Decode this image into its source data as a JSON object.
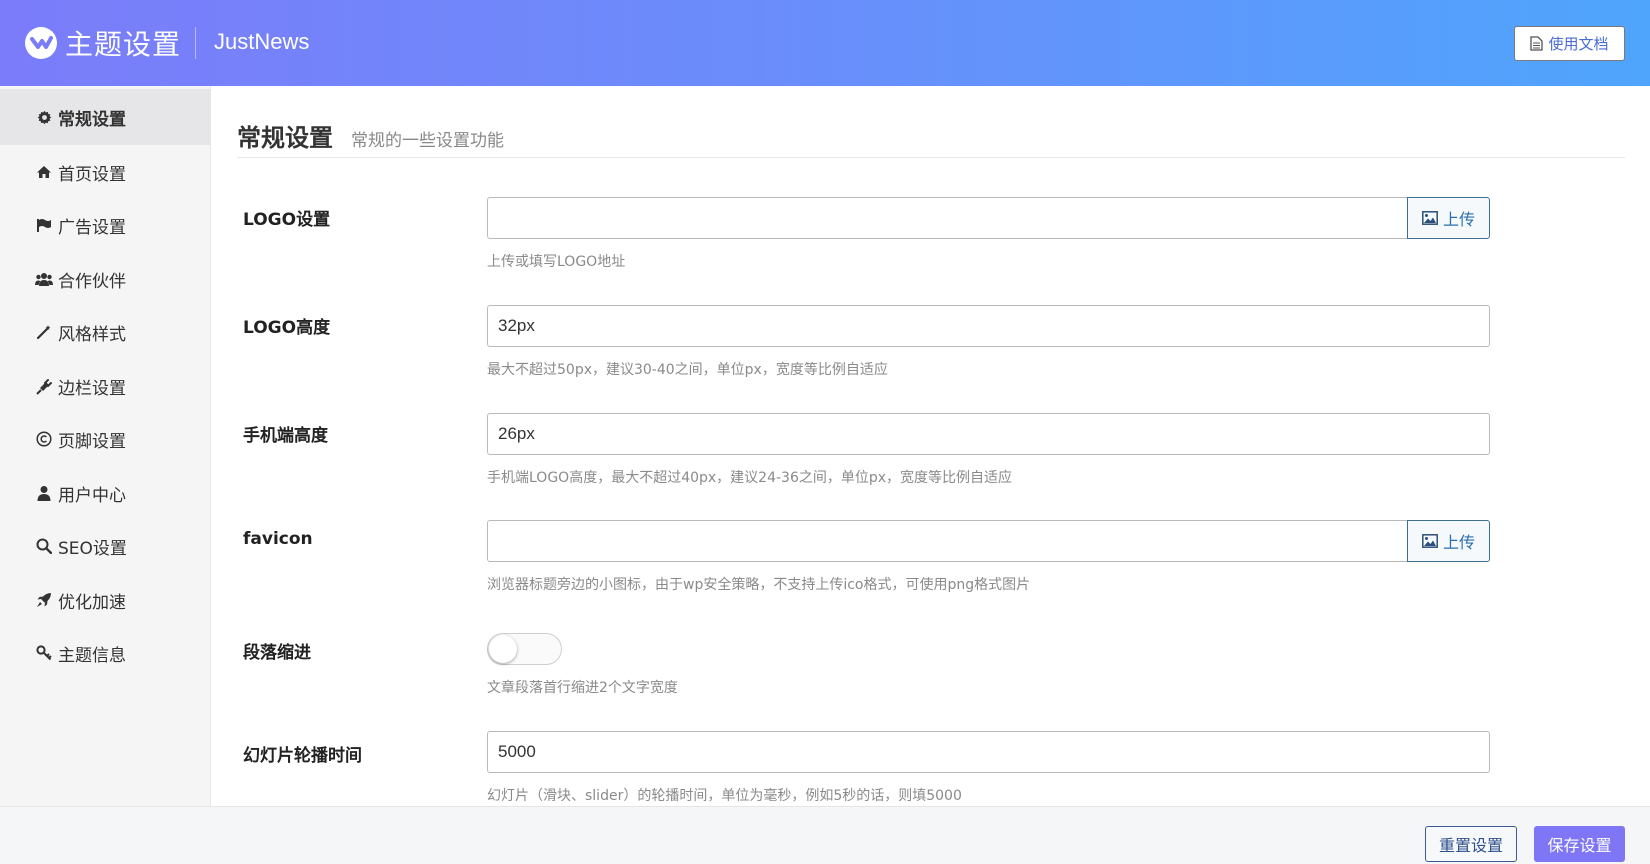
{
  "header": {
    "title": "主题设置",
    "subtitle": "JustNews",
    "docs_button": "使用文档"
  },
  "sidebar": {
    "items": [
      {
        "label": "常规设置",
        "icon": "gear-icon",
        "active": true
      },
      {
        "label": "首页设置",
        "icon": "home-icon",
        "active": false
      },
      {
        "label": "广告设置",
        "icon": "flag-icon",
        "active": false
      },
      {
        "label": "合作伙伴",
        "icon": "users-icon",
        "active": false
      },
      {
        "label": "风格样式",
        "icon": "magic-wand-icon",
        "active": false
      },
      {
        "label": "边栏设置",
        "icon": "plug-icon",
        "active": false
      },
      {
        "label": "页脚设置",
        "icon": "copyright-icon",
        "active": false
      },
      {
        "label": "用户中心",
        "icon": "user-icon",
        "active": false
      },
      {
        "label": "SEO设置",
        "icon": "search-icon",
        "active": false
      },
      {
        "label": "优化加速",
        "icon": "rocket-icon",
        "active": false
      },
      {
        "label": "主题信息",
        "icon": "key-icon",
        "active": false
      }
    ]
  },
  "main": {
    "title": "常规设置",
    "subtitle": "常规的一些设置功能",
    "fields": {
      "logo": {
        "label": "LOGO设置",
        "value": "",
        "button": "上传",
        "help": "上传或填写LOGO地址"
      },
      "logo_height": {
        "label": "LOGO高度",
        "value": "32px",
        "help": "最大不超过50px，建议30-40之间，单位px，宽度等比例自适应"
      },
      "mobile_height": {
        "label": "手机端高度",
        "value": "26px",
        "help": "手机端LOGO高度，最大不超过40px，建议24-36之间，单位px，宽度等比例自适应"
      },
      "favicon": {
        "label": "favicon",
        "value": "",
        "button": "上传",
        "help": "浏览器标题旁边的小图标，由于wp安全策略，不支持上传ico格式，可使用png格式图片"
      },
      "indent": {
        "label": "段落缩进",
        "enabled": false,
        "help": "文章段落首行缩进2个文字宽度"
      },
      "slider_time": {
        "label": "幻灯片轮播时间",
        "value": "5000",
        "help": "幻灯片（滑块、slider）的轮播时间，单位为毫秒，例如5秒的话，则填5000"
      }
    }
  },
  "footer": {
    "reset_button": "重置设置",
    "save_button": "保存设置"
  },
  "colors": {
    "header_gradient_start": "#7b7cf9",
    "header_gradient_end": "#4fa5fc",
    "save_button": "#7e76f5",
    "sidebar_bg": "#f5f5f6"
  }
}
